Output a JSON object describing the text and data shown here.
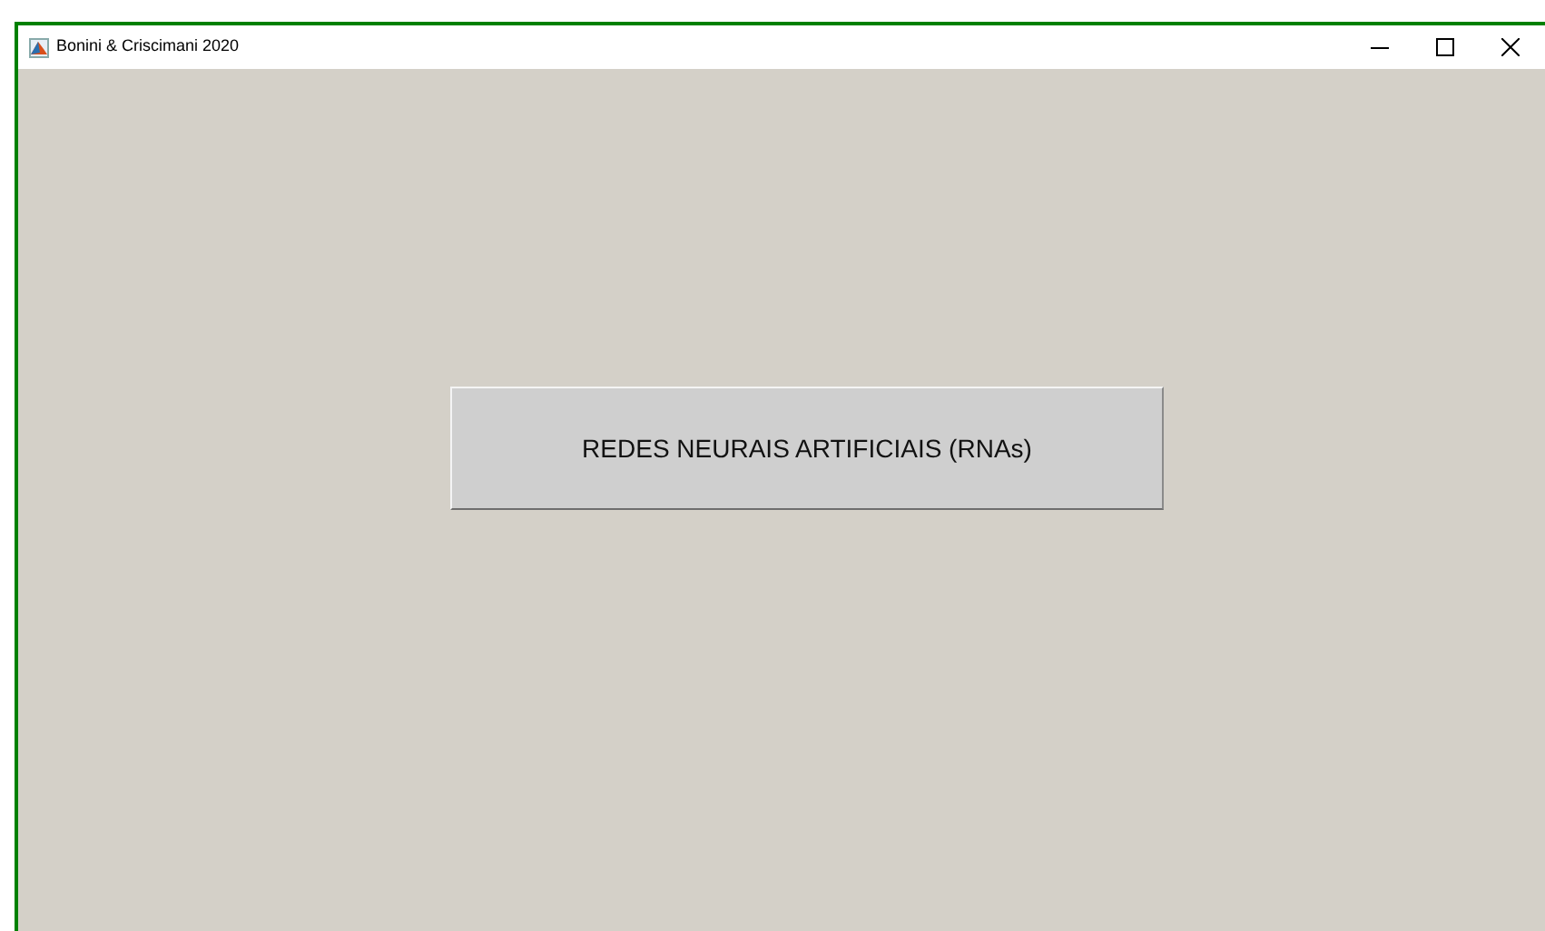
{
  "window": {
    "title": "Bonini & Criscimani 2020"
  },
  "button": {
    "label": "REDES NEURAIS ARTIFICIAIS (RNAs)"
  }
}
